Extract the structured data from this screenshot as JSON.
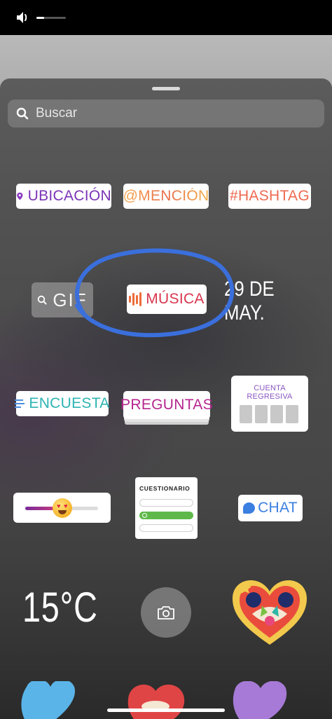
{
  "status": {
    "volume_level": 0.25
  },
  "search": {
    "placeholder": "Buscar"
  },
  "stickers": {
    "ubicacion": "UBICACIÓN",
    "mencion": "@MENCIÓN",
    "hashtag": "#HASHTAG",
    "gif": "GIF",
    "musica": "MÚSICA",
    "fecha": "29 DE MAY.",
    "encuesta": "ENCUESTA",
    "preguntas": "PREGUNTAS",
    "cuenta_regresiva": "CUENTA REGRESIVA",
    "cuestionario": "CUESTIONARIO",
    "chat": "CHAT",
    "temperatura": "15°C",
    "emoji_slider_level": 0.5
  },
  "icons": [
    "volume-icon",
    "search-icon",
    "location-icon",
    "music-icon",
    "poll-icon",
    "chat-icon",
    "camera-icon",
    "heart-art-sticker"
  ],
  "colors": {
    "annotation": "#3a6fdc",
    "ubicacion": "#7b34b6",
    "hashtag": "#ee6a50",
    "musica": "#d9364d",
    "encuesta": "#2fb3b3",
    "preguntas": "#b5268e",
    "chat": "#3b7fe0"
  }
}
